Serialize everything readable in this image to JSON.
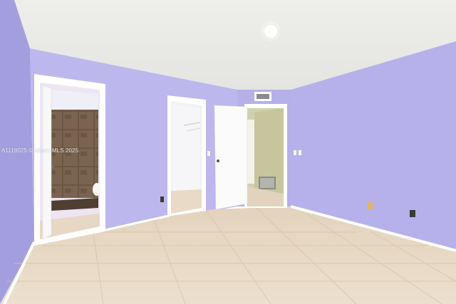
{
  "photo": {
    "watermark": "A1118025 © Miami MLS 2025"
  },
  "colors": {
    "ceiling": "#ecece9",
    "wall_left": "#a49fe0",
    "wall_back": "#b8b3ea",
    "wall_right": "#b3aee8",
    "floor": "#e8d9c6",
    "trim": "#ffffff",
    "shower_tile": "#6e5a48"
  }
}
